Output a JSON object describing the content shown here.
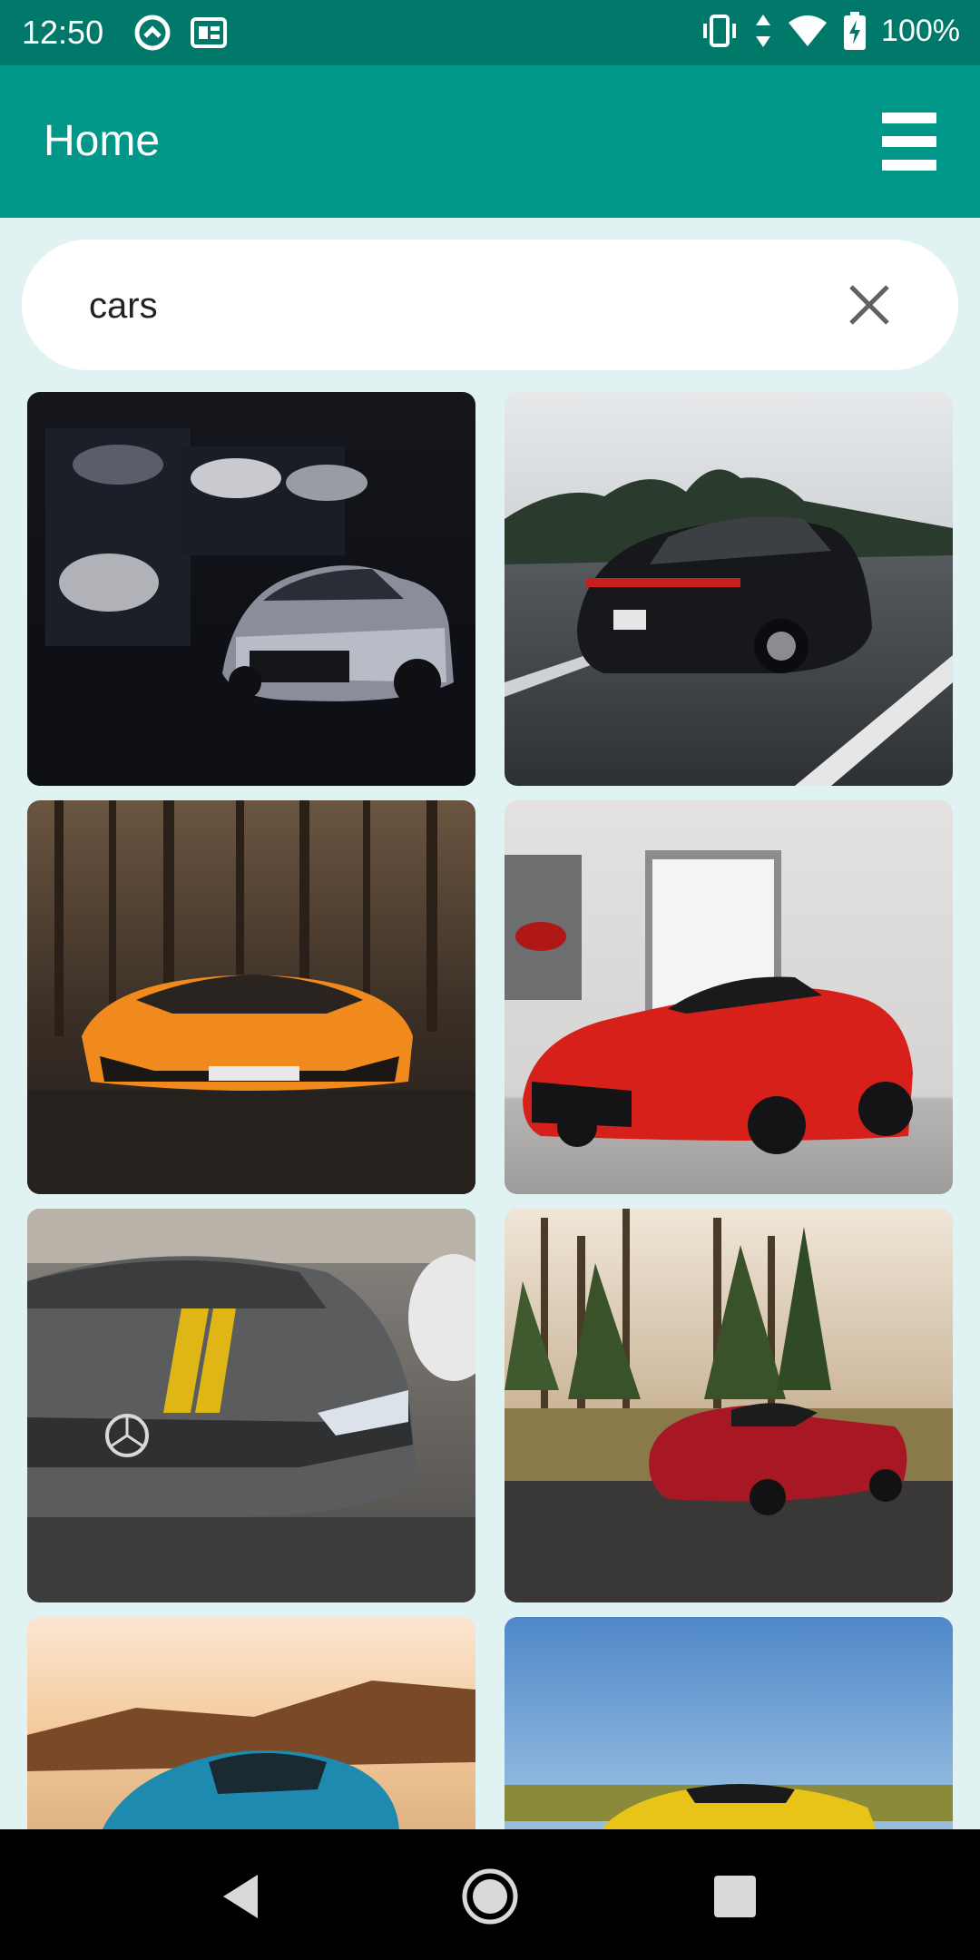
{
  "status_bar": {
    "time": "12:50",
    "battery": "100%",
    "icons": [
      "sync-icon",
      "sim-card-icon",
      "vibrate-icon",
      "data-arrows-icon",
      "wifi-icon",
      "battery-charging-icon"
    ]
  },
  "app_bar": {
    "title": "Home",
    "menu_icon": "hamburger-menu-icon"
  },
  "search": {
    "value": "cars",
    "clear_icon": "close-icon"
  },
  "results": {
    "items": [
      {
        "subject": "silver-camaro-in-dark-garage"
      },
      {
        "subject": "black-porsche-panamera-on-highway"
      },
      {
        "subject": "orange-lamborghini-in-forest"
      },
      {
        "subject": "red-ferrari-laferrari-indoors"
      },
      {
        "subject": "grey-mercedes-amg-with-yellow-stripe"
      },
      {
        "subject": "red-mercedes-amg-gt-on-road"
      },
      {
        "subject": "blue-sports-car-in-desert"
      },
      {
        "subject": "yellow-sports-car-under-blue-sky"
      }
    ]
  },
  "nav_bar": {
    "back_icon": "back-triangle-icon",
    "home_icon": "home-circle-icon",
    "recents_icon": "recents-square-icon"
  }
}
